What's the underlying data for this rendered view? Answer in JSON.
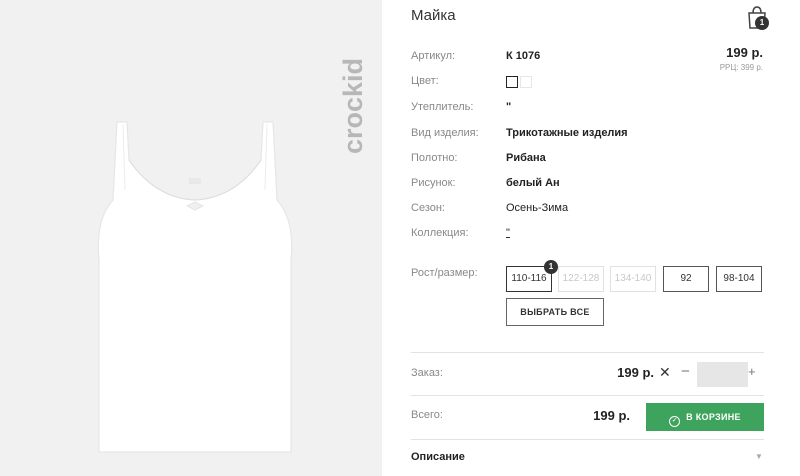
{
  "product": {
    "title": "Майка",
    "brand": "crockid",
    "price": "199 р.",
    "rrc": "РРЦ: 399 р."
  },
  "cart": {
    "badge_count": "1"
  },
  "attributes": [
    {
      "label": "Артикул:",
      "value": "К 1076"
    },
    {
      "label": "Цвет:",
      "value": ""
    },
    {
      "label": "Утеплитель:",
      "value": "\""
    },
    {
      "label": "Вид изделия:",
      "value": "Трикотажные изделия"
    },
    {
      "label": "Полотно:",
      "value": "Рибана"
    },
    {
      "label": "Рисунок:",
      "value": "белый Ан"
    },
    {
      "label": "Сезон:",
      "value": "Осень-Зима"
    },
    {
      "label": "Коллекция:",
      "value": "\""
    }
  ],
  "colors": {
    "swatches": [
      "#ffffff",
      "#ffffff"
    ],
    "accent_green": "#3ea35c"
  },
  "sizes": {
    "label": "Рост/размер:",
    "options": [
      {
        "label": "110-116",
        "state": "selected",
        "badge": "1"
      },
      {
        "label": "122-128",
        "state": "disabled"
      },
      {
        "label": "134-140",
        "state": "disabled"
      },
      {
        "label": "92",
        "state": "available"
      },
      {
        "label": "98-104",
        "state": "available"
      }
    ],
    "select_all": "ВЫБРАТЬ ВСЕ"
  },
  "order": {
    "label": "Заказ:",
    "price": "199 р.",
    "times": "✕",
    "minus": "−",
    "plus": "+",
    "quantity": ""
  },
  "total": {
    "label": "Всего:",
    "price": "199 р.",
    "button": "В КОРЗИНЕ"
  },
  "description": {
    "label": "Описание",
    "chevron": "▼"
  },
  "icons": [
    "shopping-bag-icon",
    "check-circle-icon",
    "chevron-down-icon"
  ]
}
